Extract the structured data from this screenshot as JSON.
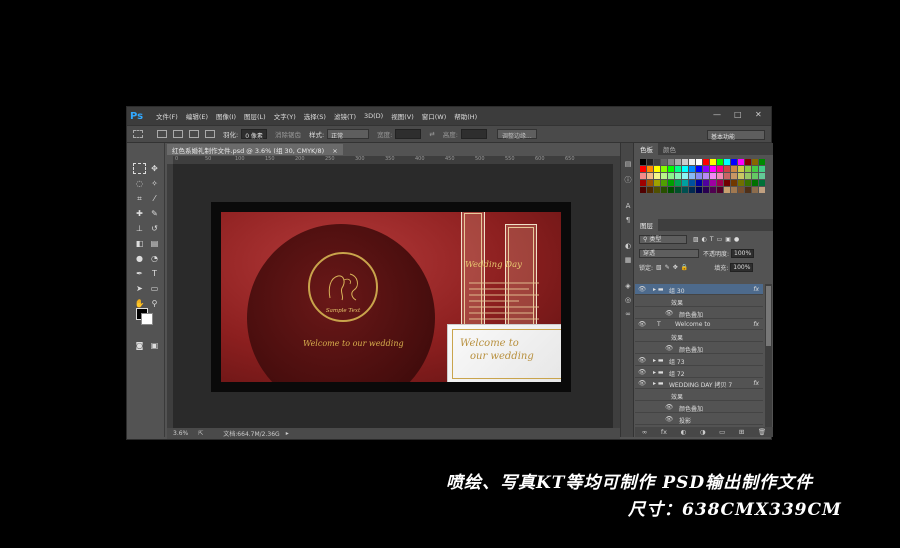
{
  "app": {
    "logo": "Ps",
    "menus": [
      "文件(F)",
      "编辑(E)",
      "图像(I)",
      "图层(L)",
      "文字(Y)",
      "选择(S)",
      "滤镜(T)",
      "3D(D)",
      "视图(V)",
      "窗口(W)",
      "帮助(H)"
    ],
    "window_controls": {
      "minimize": "—",
      "maximize": "□",
      "close": "✕"
    }
  },
  "options_bar": {
    "feather_label": "羽化:",
    "feather_value": "0 像素",
    "antialias_label": "消除锯齿",
    "style_label": "样式:",
    "style_value": "正常",
    "width_label": "宽度:",
    "height_label": "高度:",
    "refine_edge_button": "调整边缘...",
    "workspace": "基本功能"
  },
  "document": {
    "tab_title": "红色系婚礼制作文件.psd @ 3.6% (组 30, CMYK/8)",
    "tab_close": "×",
    "ruler_marks": [
      "0",
      "50",
      "100",
      "150",
      "200",
      "250",
      "300",
      "350",
      "400",
      "450",
      "500",
      "550",
      "600",
      "650"
    ],
    "zoom": "3.6%",
    "doc_info": "文档:664.7M/2.36G"
  },
  "design": {
    "ring_text": "Sample Text",
    "welcome_circle": "Welcome to our wedding",
    "wedding_day": "Wedding Day",
    "welcome_card_line1": "Welcome to",
    "welcome_card_line2": "our wedding"
  },
  "panels": {
    "swatch_tabs": [
      "色板",
      "颜色"
    ],
    "layers_tabs": [
      "图层"
    ],
    "kind_label": "类型",
    "blend_mode": "穿透",
    "opacity_label": "不透明度:",
    "opacity_value": "100%",
    "lock_label": "锁定:",
    "fill_label": "填充:",
    "fill_value": "100%",
    "swatch_colors": [
      "#000000",
      "#222222",
      "#444444",
      "#666666",
      "#888888",
      "#aaaaaa",
      "#cccccc",
      "#eeeeee",
      "#ffffff",
      "#ff0000",
      "#ffff00",
      "#00ff00",
      "#00ffff",
      "#0000ff",
      "#ff00ff",
      "#880000",
      "#886600",
      "#008800",
      "#ff0000",
      "#ff8800",
      "#ffff00",
      "#88ff00",
      "#00ff00",
      "#00ff88",
      "#00ffff",
      "#0088ff",
      "#0000ff",
      "#8800ff",
      "#ff00ff",
      "#ff0088",
      "#cc4444",
      "#cc8844",
      "#cccc44",
      "#88cc44",
      "#44cc44",
      "#44cc88",
      "#f48a8a",
      "#f4b88a",
      "#f4f48a",
      "#b8f48a",
      "#8af48a",
      "#8af4b8",
      "#8af4f4",
      "#8ab8f4",
      "#8a8af4",
      "#b88af4",
      "#f48af4",
      "#f48ab8",
      "#c86464",
      "#c89664",
      "#c8c864",
      "#96c864",
      "#64c864",
      "#64c896",
      "#a00000",
      "#a05000",
      "#a0a000",
      "#50a000",
      "#00a000",
      "#00a050",
      "#00a0a0",
      "#0050a0",
      "#0000a0",
      "#5000a0",
      "#a000a0",
      "#a00050",
      "#700000",
      "#703800",
      "#707000",
      "#387000",
      "#007000",
      "#007038",
      "#500000",
      "#502800",
      "#505000",
      "#285000",
      "#005000",
      "#005028",
      "#005050",
      "#002850",
      "#000050",
      "#280050",
      "#500050",
      "#500028",
      "#c8a070",
      "#a07850",
      "#785030",
      "#503018",
      "#8c6c4c",
      "#c0a080"
    ],
    "layers": [
      {
        "name": "组 30",
        "indent": 1,
        "type": "group",
        "fx": "fx",
        "selected": true
      },
      {
        "name": "效果",
        "indent": 2,
        "type": "effect"
      },
      {
        "name": "颜色叠加",
        "indent": 3,
        "type": "effect"
      },
      {
        "name": "Welcome to",
        "indent": 1,
        "type": "text",
        "fx": "fx"
      },
      {
        "name": "效果",
        "indent": 2,
        "type": "effect"
      },
      {
        "name": "颜色叠加",
        "indent": 3,
        "type": "effect"
      },
      {
        "name": "组 73",
        "indent": 1,
        "type": "group"
      },
      {
        "name": "组 72",
        "indent": 1,
        "type": "group"
      },
      {
        "name": "WEDDING DAY 拷贝 7",
        "indent": 1,
        "type": "group",
        "fx": "fx"
      },
      {
        "name": "效果",
        "indent": 2,
        "type": "effect"
      },
      {
        "name": "颜色叠加",
        "indent": 3,
        "type": "effect"
      },
      {
        "name": "投影",
        "indent": 3,
        "type": "effect"
      }
    ],
    "footer_icons": [
      "∞",
      "fx",
      "◐",
      "◑",
      "▭",
      "⊞",
      "🗑"
    ]
  },
  "caption": {
    "line1": "喷绘、写真KT等均可制作  PSD输出制作文件",
    "line2": "尺寸：638CMX339CM"
  }
}
